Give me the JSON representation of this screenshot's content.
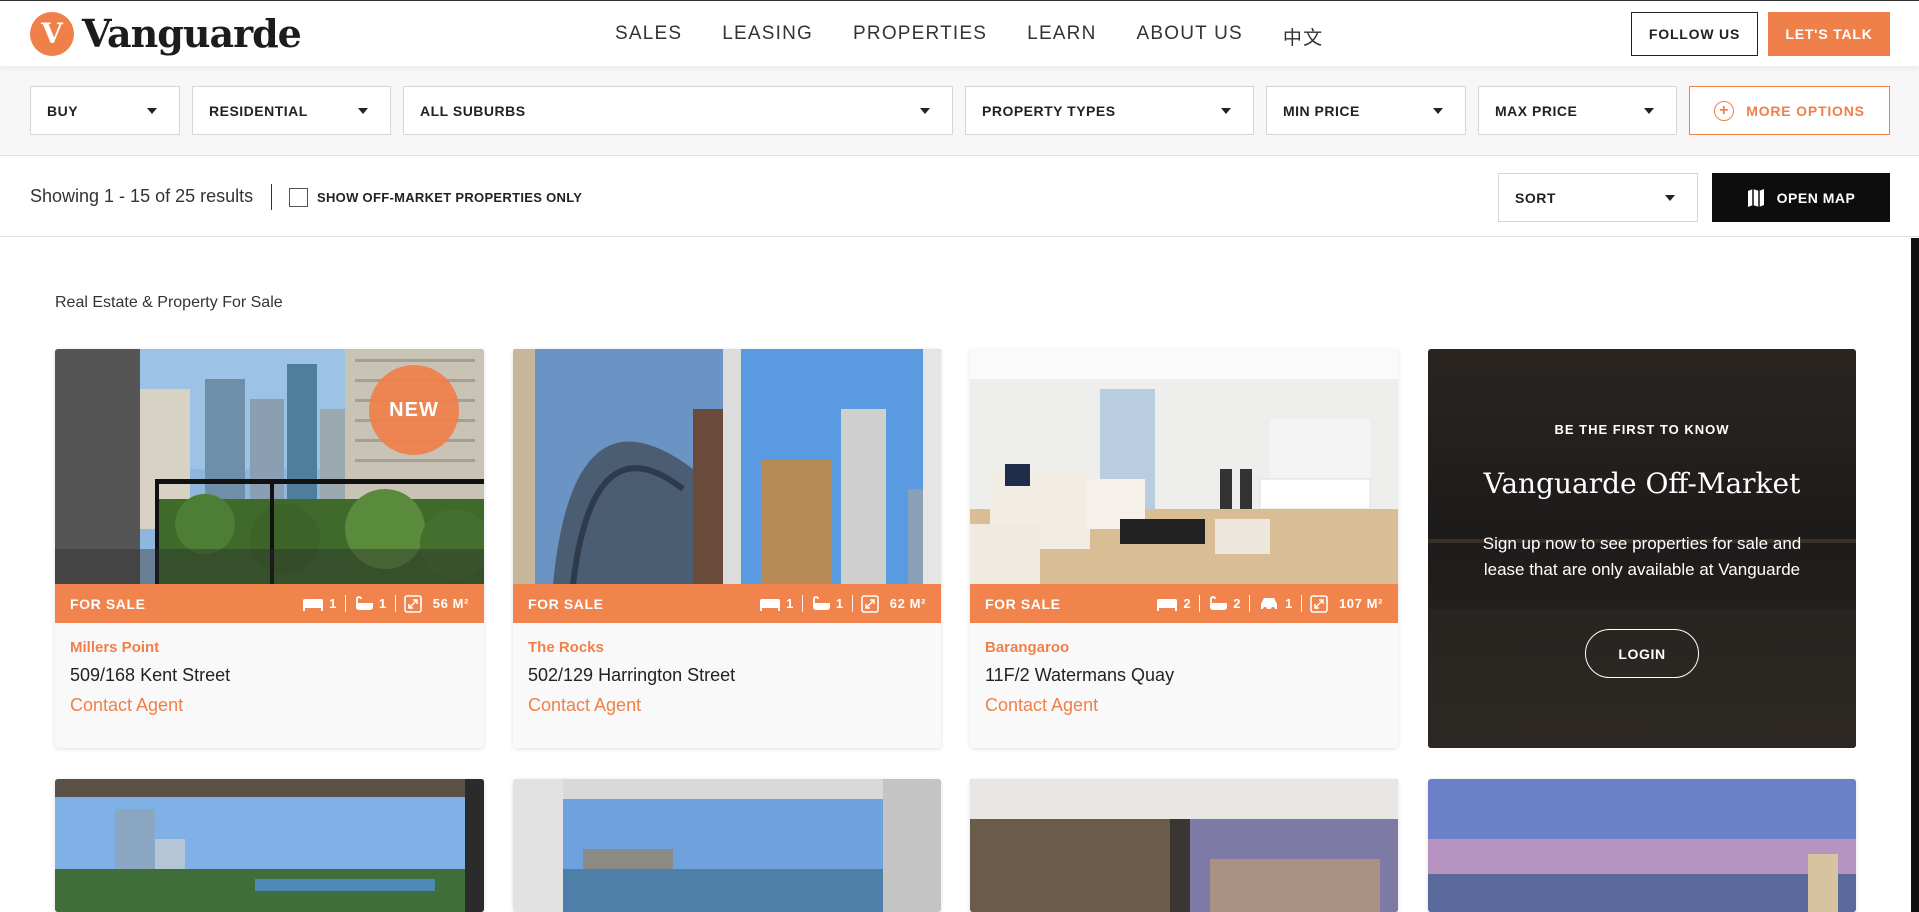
{
  "header": {
    "logo_mark": "V",
    "logo_text": "Vanguarde",
    "nav": [
      "SALES",
      "LEASING",
      "PROPERTIES",
      "LEARN",
      "ABOUT US",
      "中文"
    ],
    "follow_label": "FOLLOW US",
    "talk_label": "LET'S TALK"
  },
  "filters": {
    "buy": "BUY",
    "category": "RESIDENTIAL",
    "suburbs": "ALL SUBURBS",
    "types": "PROPERTY TYPES",
    "min_price": "MIN PRICE",
    "max_price": "MAX PRICE",
    "more_options": "MORE OPTIONS"
  },
  "results": {
    "count_text": "Showing 1 - 15 of 25 results",
    "off_market_label": "SHOW OFF-MARKET PROPERTIES ONLY",
    "sort_label": "SORT",
    "open_map_label": "OPEN MAP"
  },
  "page_heading": "Real Estate & Property For Sale",
  "listings": [
    {
      "badge": "NEW",
      "status": "FOR SALE",
      "beds": "1",
      "baths": "1",
      "area": "56 M²",
      "suburb": "Millers Point",
      "address": "509/168 Kent Street",
      "price": "Contact Agent"
    },
    {
      "status": "FOR SALE",
      "beds": "1",
      "baths": "1",
      "area": "62 M²",
      "suburb": "The Rocks",
      "address": "502/129 Harrington Street",
      "price": "Contact Agent"
    },
    {
      "status": "FOR SALE",
      "beds": "2",
      "baths": "2",
      "cars": "1",
      "area": "107 M²",
      "suburb": "Barangaroo",
      "address": "11F/2 Watermans Quay",
      "price": "Contact Agent"
    }
  ],
  "promo": {
    "kicker": "BE THE FIRST TO KNOW",
    "title": "Vanguarde Off-Market",
    "text": "Sign up now to see properties for sale and lease that are only available at Vanguarde",
    "login_label": "LOGIN"
  },
  "colors": {
    "accent": "#f0804a",
    "dark": "#0d0d0d"
  }
}
